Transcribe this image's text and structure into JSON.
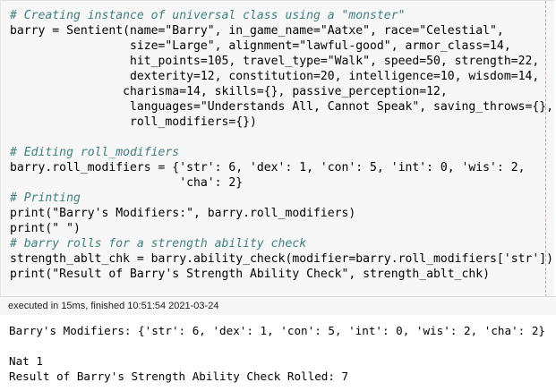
{
  "code_cell": {
    "lines": [
      {
        "kind": "comment",
        "text": "# Creating instance of universal class using a \"monster\""
      },
      {
        "kind": "code",
        "text": "barry = Sentient(name=\"Barry\", in_game_name=\"Aatxe\", race=\"Celestial\","
      },
      {
        "kind": "code",
        "text": "                 size=\"Large\", alignment=\"lawful-good\", armor_class=14,"
      },
      {
        "kind": "code",
        "text": "                 hit_points=105, travel_type=\"Walk\", speed=50, strength=22,"
      },
      {
        "kind": "code",
        "text": "                 dexterity=12, constitution=20, intelligence=10, wisdom=14,"
      },
      {
        "kind": "code",
        "text": "                charisma=14, skills={}, passive_perception=12,"
      },
      {
        "kind": "code",
        "text": "                 languages=\"Understands All, Cannot Speak\", saving_throws={},"
      },
      {
        "kind": "code",
        "text": "                 roll_modifiers={})"
      },
      {
        "kind": "blank",
        "text": ""
      },
      {
        "kind": "comment",
        "text": "# Editing roll_modifiers"
      },
      {
        "kind": "code",
        "text": "barry.roll_modifiers = {'str': 6, 'dex': 1, 'con': 5, 'int': 0, 'wis': 2,"
      },
      {
        "kind": "code",
        "text": "                        'cha': 2}"
      },
      {
        "kind": "comment",
        "text": "# Printing"
      },
      {
        "kind": "code",
        "text": "print(\"Barry's Modifiers:\", barry.roll_modifiers)"
      },
      {
        "kind": "code",
        "text": "print(\" \")"
      },
      {
        "kind": "comment",
        "text": "# barry rolls for a strength ability check"
      },
      {
        "kind": "code",
        "text": "strength_ablt_chk = barry.ability_check(modifier=barry.roll_modifiers['str'])"
      },
      {
        "kind": "code",
        "text": "print(\"Result of Barry's Strength Ability Check\", strength_ablt_chk)"
      }
    ]
  },
  "exec_status": "executed in 15ms, finished 10:51:54 2021-03-24",
  "output": {
    "lines": [
      "Barry's Modifiers: {'str': 6, 'dex': 1, 'con': 5, 'int': 0, 'wis': 2, 'cha': 2}",
      "",
      "Nat 1",
      "Result of Barry's Strength Ability Check Rolled: 7"
    ]
  }
}
